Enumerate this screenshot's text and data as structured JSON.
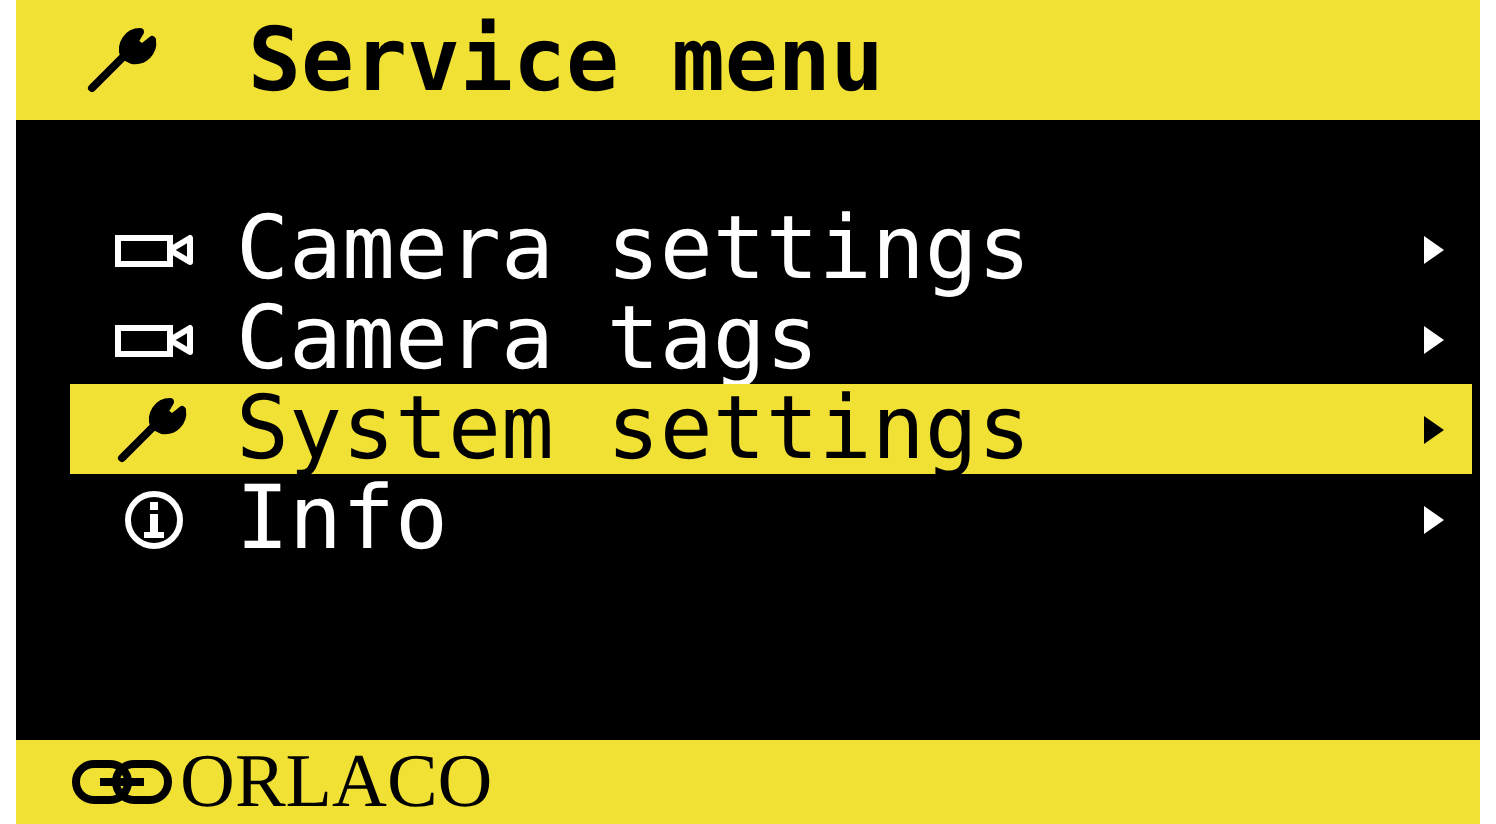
{
  "header": {
    "title": "Service menu"
  },
  "menu": {
    "items": [
      {
        "kind": "camera",
        "label": "Camera settings",
        "selected": false
      },
      {
        "kind": "camera",
        "label": "Camera tags",
        "selected": false
      },
      {
        "kind": "wrench",
        "label": "System settings",
        "selected": true
      },
      {
        "kind": "info",
        "label": "Info",
        "selected": false
      }
    ]
  },
  "footer": {
    "brand": "ORLACO"
  }
}
